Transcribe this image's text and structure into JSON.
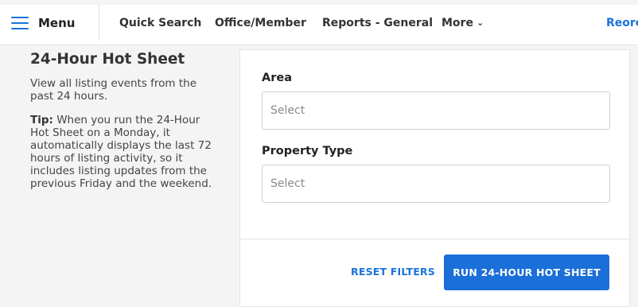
{
  "nav": {
    "menu_label": "Menu",
    "items": [
      {
        "label": "Quick Search"
      },
      {
        "label": "Office/Member"
      },
      {
        "label": "Reports - General"
      },
      {
        "label": "More"
      },
      {
        "label": "Reorc"
      }
    ]
  },
  "sidebar": {
    "title": "24-Hour Hot Sheet",
    "description": "View all listing events from the past 24 hours.",
    "tip_label": "Tip:",
    "tip_text": " When you run the 24-Hour Hot Sheet on a Monday, it automatically displays the last 72 hours of listing activity, so it includes listing updates from the previous Friday and the weekend."
  },
  "form": {
    "area": {
      "label": "Area",
      "placeholder": "Select"
    },
    "property_type": {
      "label": "Property Type",
      "placeholder": "Select"
    },
    "reset_label": "RESET FILTERS",
    "run_label": "RUN 24-HOUR HOT SHEET"
  },
  "colors": {
    "accent": "#1a73d9",
    "button": "#1a6fd8",
    "background": "#f4f4f5"
  }
}
